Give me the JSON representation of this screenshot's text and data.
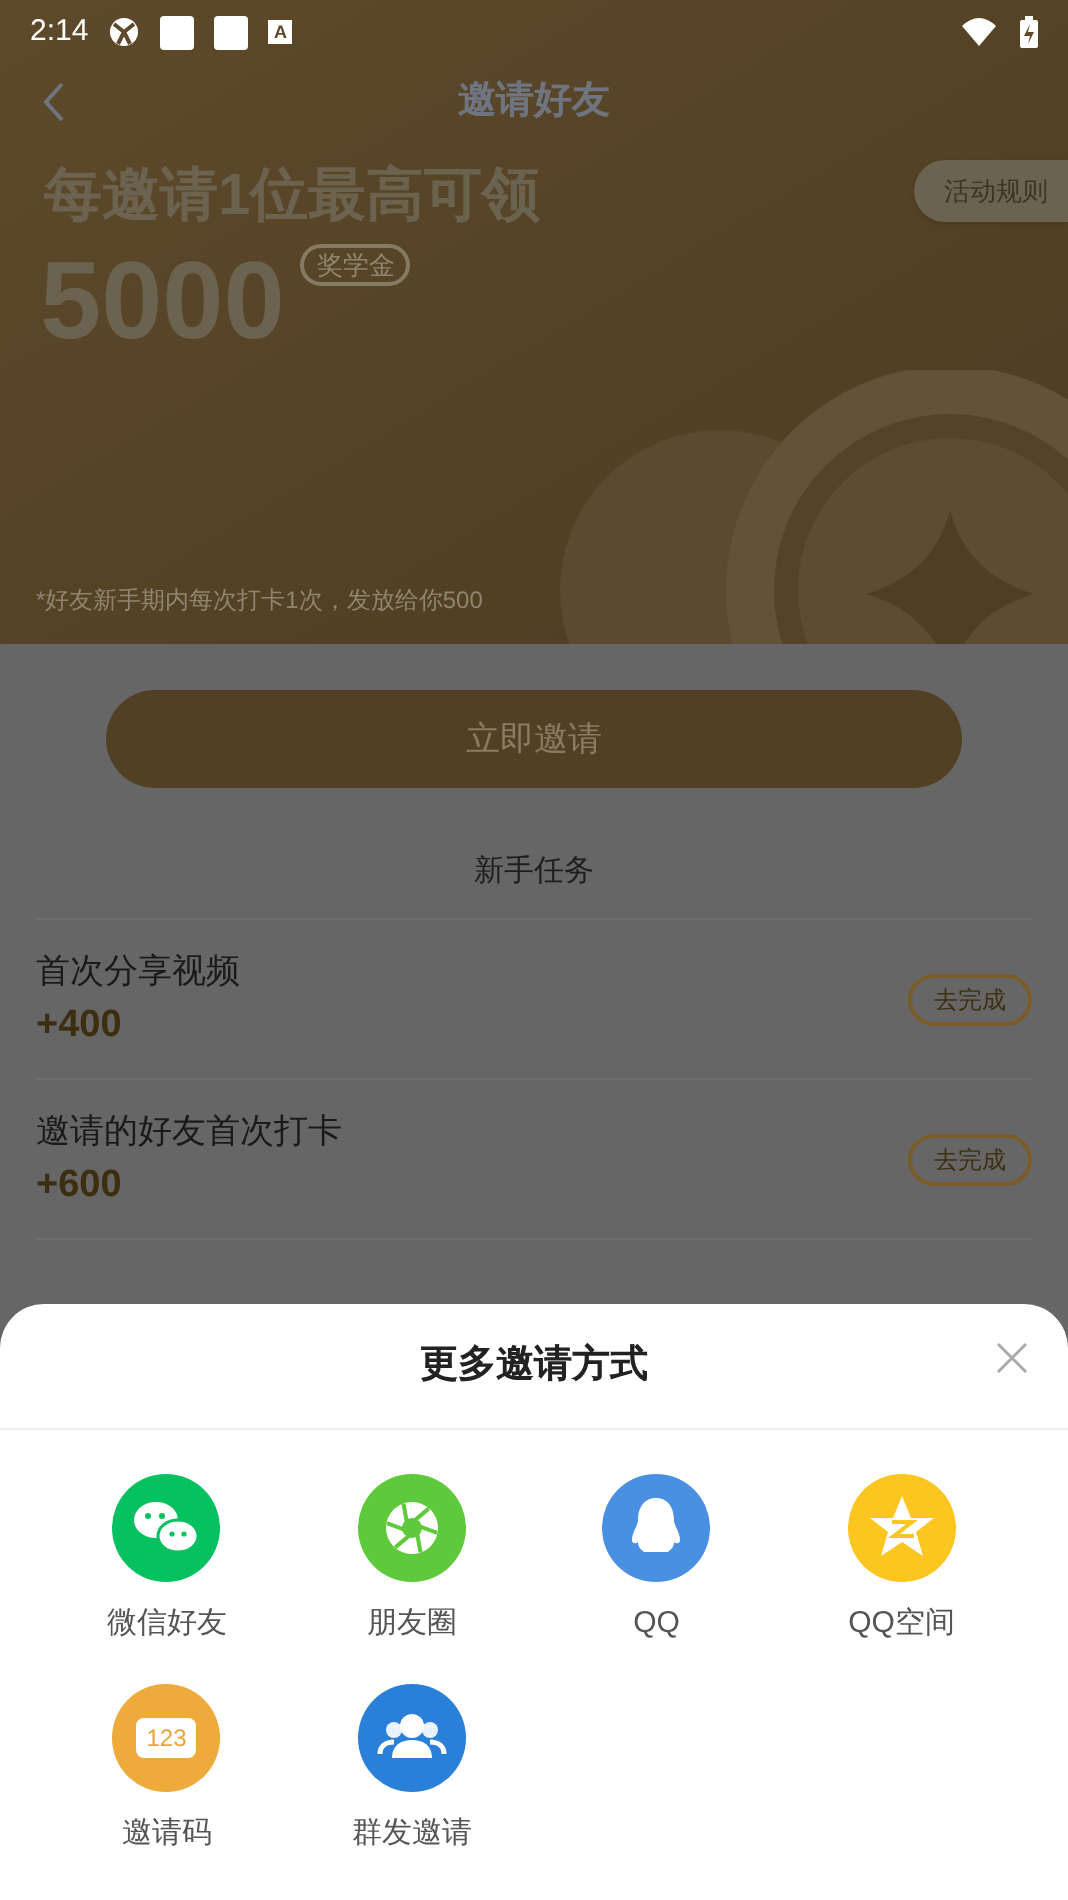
{
  "status_bar": {
    "time": "2:14",
    "notification_letter": "A"
  },
  "nav": {
    "title": "邀请好友"
  },
  "hero": {
    "headline": "每邀请1位最高可领",
    "amount": "5000",
    "amount_tag": "奖学金",
    "rules_button": "活动规则",
    "footnote": "*好友新手期内每次打卡1次，发放给你500"
  },
  "invite_button": "立即邀请",
  "tasks": {
    "title": "新手任务",
    "items": [
      {
        "name": "首次分享视频",
        "reward": "+400",
        "action": "去完成"
      },
      {
        "name": "邀请的好友首次打卡",
        "reward": "+600",
        "action": "去完成"
      }
    ]
  },
  "sheet": {
    "title": "更多邀请方式",
    "options": [
      {
        "kind": "wechat",
        "label": "微信好友",
        "color": "#07c160"
      },
      {
        "kind": "moments",
        "label": "朋友圈",
        "color": "#5fc93c"
      },
      {
        "kind": "qq",
        "label": "QQ",
        "color": "#4a90e2"
      },
      {
        "kind": "qzone",
        "label": "QQ空间",
        "color": "#fdc51f"
      },
      {
        "kind": "code",
        "label": "邀请码",
        "color": "#eeaa3a",
        "badge_text": "123"
      },
      {
        "kind": "group",
        "label": "群发邀请",
        "color": "#2a7fd8"
      }
    ]
  }
}
